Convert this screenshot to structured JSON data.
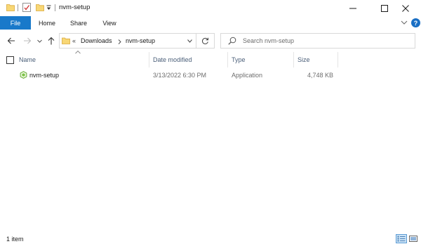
{
  "window": {
    "title": "nvm-setup",
    "controls": {
      "minimize": "minimize",
      "maximize": "maximize",
      "close": "close"
    }
  },
  "ribbon": {
    "tabs": [
      {
        "label": "File",
        "active": true
      },
      {
        "label": "Home"
      },
      {
        "label": "Share"
      },
      {
        "label": "View"
      }
    ],
    "help_label": "?"
  },
  "address": {
    "overflow": "«",
    "crumbs": [
      "Downloads",
      "nvm-setup"
    ]
  },
  "search": {
    "placeholder": "Search nvm-setup"
  },
  "columns": [
    "Name",
    "Date modified",
    "Type",
    "Size"
  ],
  "files": [
    {
      "name": "nvm-setup",
      "date_modified": "3/13/2022 6:30 PM",
      "type": "Application",
      "size": "4,748 KB"
    }
  ],
  "status": {
    "item_count": "1 item"
  },
  "colors": {
    "accent": "#1979ca",
    "header_text": "#4c607a",
    "folder": "#f8d775"
  }
}
